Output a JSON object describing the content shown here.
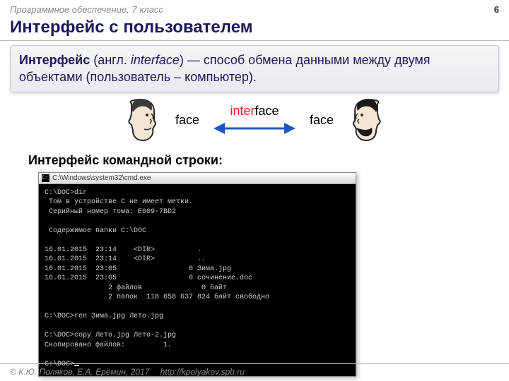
{
  "header": {
    "subject": "Программное обеспечение, 7 класс",
    "page": "6"
  },
  "title": "Интерфейс с пользователем",
  "definition": {
    "term": "Интерфейс",
    "paren_open": " (англ. ",
    "english": "interface",
    "paren_close": ") — способ обмена данными между двумя объектами (пользователь – компьютер)."
  },
  "diagram": {
    "left_label": "face",
    "center_red": "inter",
    "center_black": "face",
    "right_label": "face"
  },
  "subhead": "Интерфейс командной строки:",
  "cmd": {
    "title": "C:\\Windows\\system32\\cmd.exe",
    "lines": [
      "C:\\DOC>dir",
      " Том в устройстве C не имеет метки.",
      " Серийный номер тома: E009-7BD2",
      "",
      " Содержимое папки C:\\DOC",
      "",
      "16.01.2015  23:14    <DIR>          .",
      "16.01.2015  23:14    <DIR>          ..",
      "16.01.2015  23:05                 0 Зима.jpg",
      "16.01.2015  23:05                 0 сочинение.doc",
      "               2 файлов              0 байт",
      "               2 папок  118 658 637 824 байт свободно",
      "",
      "C:\\DOC>ren Зима.jpg Лето.jpg",
      "",
      "C:\\DOC>copy Лето.jpg Лето-2.jpg",
      "Скопировано файлов:         1.",
      "",
      "C:\\DOC>"
    ]
  },
  "footer": {
    "copyright": "© К.Ю. Поляков, Е.А. Ерёмин, 2017",
    "link": "http://kpolyakov.spb.ru"
  }
}
